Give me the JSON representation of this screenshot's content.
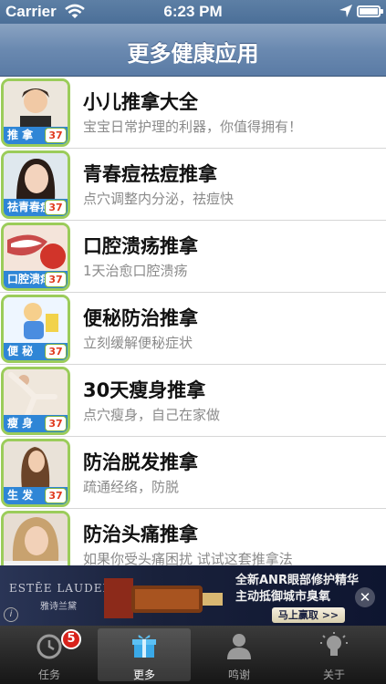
{
  "status_bar": {
    "carrier": "Carrier",
    "time": "6:23 PM"
  },
  "nav": {
    "title": "更多健康应用"
  },
  "apps": [
    {
      "name": "小儿推拿大全",
      "desc": "宝宝日常护理的利器，你值得拥有！",
      "caption": "推 拿",
      "badge": "37"
    },
    {
      "name": "青春痘祛痘推拿",
      "desc": "点穴调整内分泌，祛痘快",
      "caption": "祛青春痘",
      "badge": "37"
    },
    {
      "name": "口腔溃疡推拿",
      "desc": "1天治愈口腔溃疡",
      "caption": "口腔溃疡",
      "badge": "37"
    },
    {
      "name": "便秘防治推拿",
      "desc": "立刻缓解便秘症状",
      "caption": "便 秘",
      "badge": "37"
    },
    {
      "name": "30天瘦身推拿",
      "desc": "点穴瘦身，自己在家做",
      "caption": "瘦 身",
      "badge": "37"
    },
    {
      "name": "防治脱发推拿",
      "desc": "疏通经络，防脱",
      "caption": "生 发",
      "badge": "37"
    },
    {
      "name": "防治头痛推拿",
      "desc": "如果你受头痛困扰 试试这套推拿法",
      "caption": "",
      "badge": ""
    }
  ],
  "ad": {
    "brand": "ESTĒE LAUDER",
    "brand_cn": "雅诗兰黛",
    "headline_1": "全新ANR眼部修护精华",
    "headline_2": "主动抵御城市臭氧",
    "cta": "马上赢取 >>",
    "close": "✕",
    "info": "i"
  },
  "tabs": [
    {
      "label": "任务",
      "count": "5"
    },
    {
      "label": "更多"
    },
    {
      "label": "鸣谢"
    },
    {
      "label": "关于"
    }
  ],
  "colors": {
    "tab_active": "#ffffff",
    "accent": "#2f86d6",
    "thumb_border": "#9bcc5a"
  }
}
